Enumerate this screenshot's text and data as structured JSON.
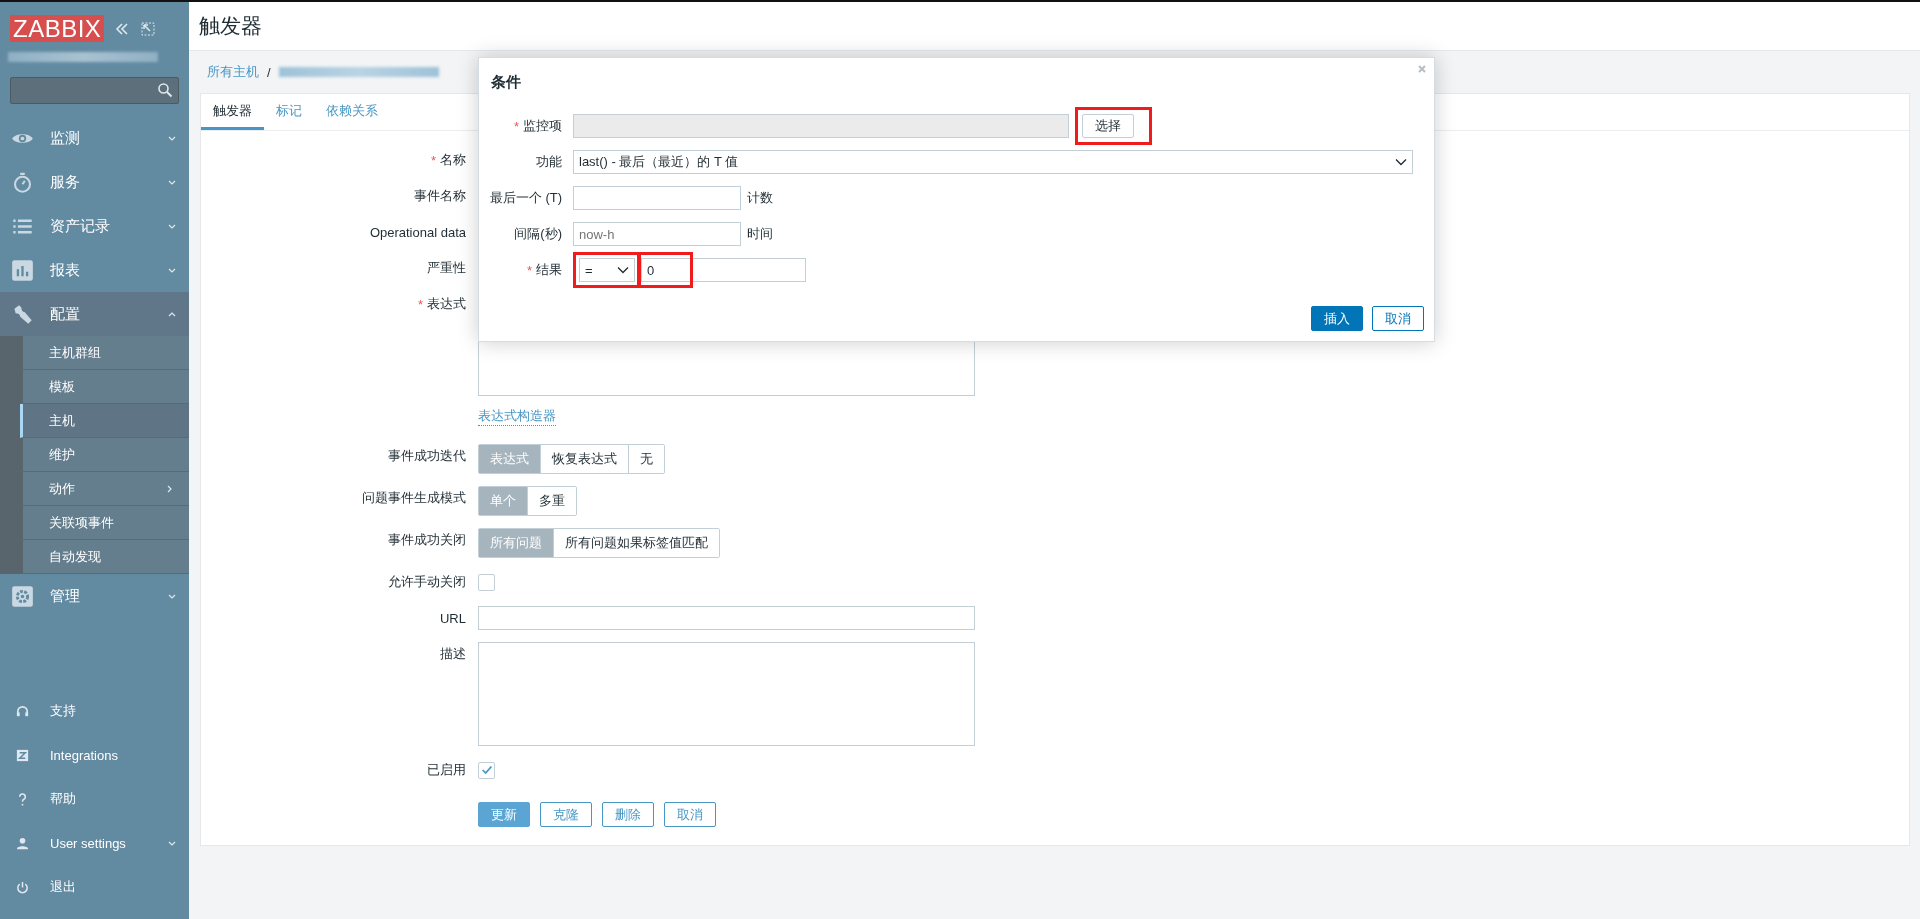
{
  "sidebar": {
    "logo": "ZABBIX",
    "menu": [
      {
        "label": "监测",
        "expanded": false
      },
      {
        "label": "服务",
        "expanded": false
      },
      {
        "label": "资产记录",
        "expanded": false
      },
      {
        "label": "报表",
        "expanded": false
      },
      {
        "label": "配置",
        "expanded": true,
        "children": [
          {
            "label": "主机群组",
            "selected": false,
            "submenu": false
          },
          {
            "label": "模板",
            "selected": false,
            "submenu": false
          },
          {
            "label": "主机",
            "selected": true,
            "submenu": false
          },
          {
            "label": "维护",
            "selected": false,
            "submenu": false
          },
          {
            "label": "动作",
            "selected": false,
            "submenu": true
          },
          {
            "label": "关联项事件",
            "selected": false,
            "submenu": false
          },
          {
            "label": "自动发现",
            "selected": false,
            "submenu": false
          }
        ]
      },
      {
        "label": "管理",
        "expanded": false
      }
    ],
    "bottom": [
      {
        "label": "支持",
        "expandable": false
      },
      {
        "label": "Integrations",
        "expandable": false
      },
      {
        "label": "帮助",
        "expandable": false
      },
      {
        "label": "User settings",
        "expandable": true
      },
      {
        "label": "退出",
        "expandable": false
      }
    ]
  },
  "page": {
    "title": "触发器",
    "breadcrumb": [
      {
        "label": "所有主机",
        "separator": "/"
      }
    ]
  },
  "tabs": [
    {
      "label": "触发器",
      "selected": true
    },
    {
      "label": "标记",
      "selected": false
    },
    {
      "label": "依赖关系",
      "selected": false
    }
  ],
  "form": [
    {
      "kind": "text",
      "label": "名称",
      "required_mark": "*"
    },
    {
      "kind": "text",
      "label": "事件名称"
    },
    {
      "kind": "text",
      "label": "Operational data"
    },
    {
      "kind": "text",
      "label": "严重性"
    },
    {
      "kind": "textarea",
      "label": "表达式",
      "required_mark": "*"
    },
    {
      "kind": "link",
      "text": "表达式构造器"
    },
    {
      "kind": "segmented",
      "label": "事件成功迭代",
      "options": [
        {
          "label": "表达式",
          "selected": true
        },
        {
          "label": "恢复表达式",
          "selected": false
        },
        {
          "label": "无",
          "selected": false
        }
      ]
    },
    {
      "kind": "segmented",
      "label": "问题事件生成模式",
      "options": [
        {
          "label": "单个",
          "selected": true
        },
        {
          "label": "多重",
          "selected": false
        }
      ]
    },
    {
      "kind": "segmented",
      "label": "事件成功关闭",
      "options": [
        {
          "label": "所有问题",
          "selected": true
        },
        {
          "label": "所有问题如果标签值匹配",
          "selected": false
        }
      ]
    },
    {
      "kind": "checkbox",
      "label": "允许手动关闭",
      "checked": false
    },
    {
      "kind": "text",
      "label": "URL"
    },
    {
      "kind": "textarea",
      "label": "描述"
    },
    {
      "kind": "checkbox",
      "label": "已启用",
      "checked": true
    },
    {
      "kind": "buttons",
      "buttons": [
        {
          "label": "更新",
          "primary": true
        },
        {
          "label": "克隆",
          "primary": false
        },
        {
          "label": "删除",
          "primary": false
        },
        {
          "label": "取消",
          "primary": false
        }
      ]
    }
  ],
  "dialog": {
    "title": "条件",
    "fields": [
      {
        "kind": "item",
        "label": "监控项",
        "required_mark": "*",
        "button": "选择",
        "highlighted": true
      },
      {
        "kind": "select",
        "label": "功能",
        "value": "last() - 最后（最近）的 T 值"
      },
      {
        "kind": "input",
        "label": "最后一个 (T)",
        "unit": "计数"
      },
      {
        "kind": "input",
        "label": "间隔(秒)",
        "placeholder": "now-h",
        "unit": "时间"
      },
      {
        "kind": "result",
        "label": "结果",
        "required_mark": "*",
        "operator": "=",
        "value": "0",
        "highlighted": true
      }
    ],
    "buttons": [
      {
        "label": "插入",
        "primary": true
      },
      {
        "label": "取消",
        "primary": false
      }
    ]
  }
}
